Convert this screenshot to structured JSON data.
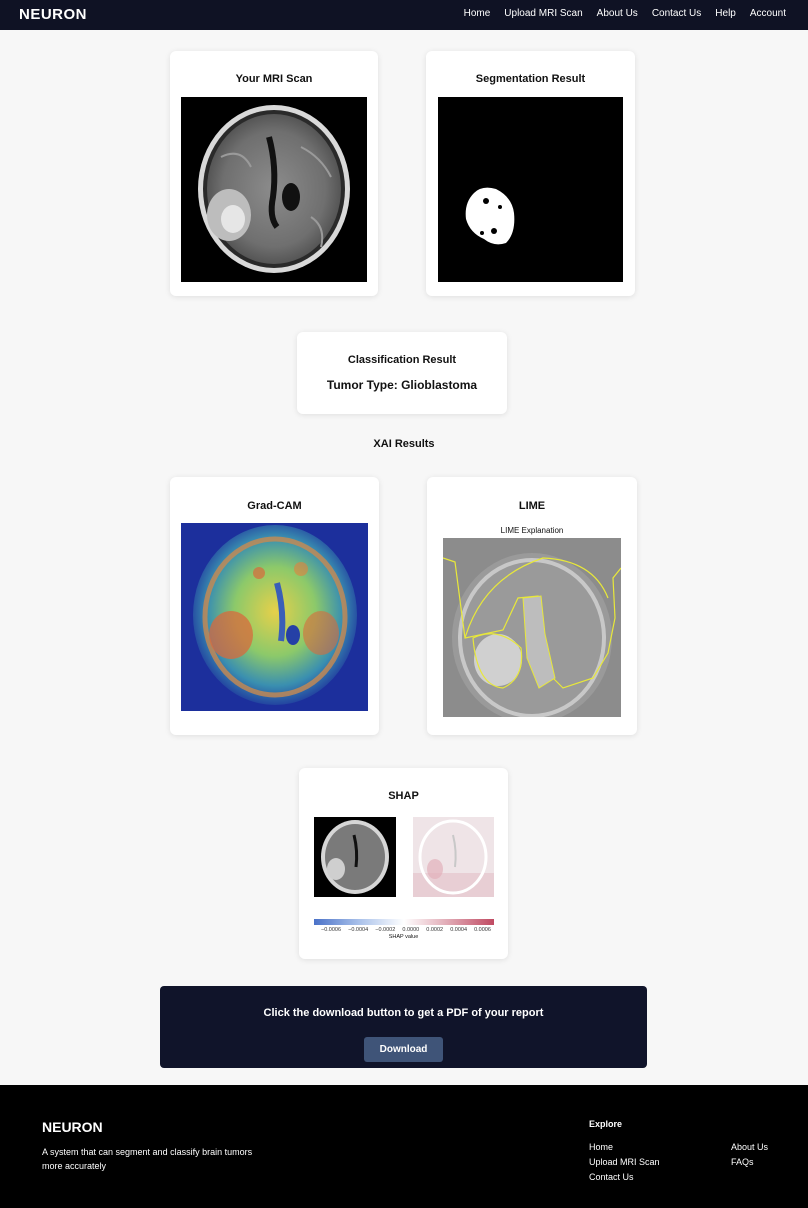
{
  "nav": {
    "logo": "NEURON",
    "links": [
      "Home",
      "Upload MRI Scan",
      "About Us",
      "Contact Us",
      "Help",
      "Account"
    ]
  },
  "cards": {
    "mri_title": "Your MRI Scan",
    "seg_title": "Segmentation Result",
    "class_title": "Classification Result",
    "class_result": "Tumor Type: Glioblastoma",
    "xai_title": "XAI Results",
    "gradcam_title": "Grad-CAM",
    "lime_title": "LIME",
    "lime_plot_title": "LIME Explanation",
    "shap_title": "SHAP",
    "shap_ticks": [
      "−0.0006",
      "−0.0004",
      "−0.0002",
      "0.0000",
      "0.0002",
      "0.0004",
      "0.0006"
    ],
    "shap_axis_label": "SHAP value"
  },
  "cta": {
    "text": "Click the download button to get a PDF of your report",
    "button": "Download"
  },
  "footer": {
    "logo": "NEURON",
    "description": "A system that can segment and classify brain tumors more accurately",
    "explore_title": "Explore",
    "links_col1": [
      "Home",
      "Upload MRI Scan",
      "Contact Us"
    ],
    "links_col2": [
      "About Us",
      "FAQs"
    ]
  },
  "colors": {
    "nav_bg": "#0f1224",
    "cta_bg": "#10142a",
    "button_bg": "#3f5478",
    "footer_bg": "#000000",
    "lime_outline": "#e8e83a"
  }
}
